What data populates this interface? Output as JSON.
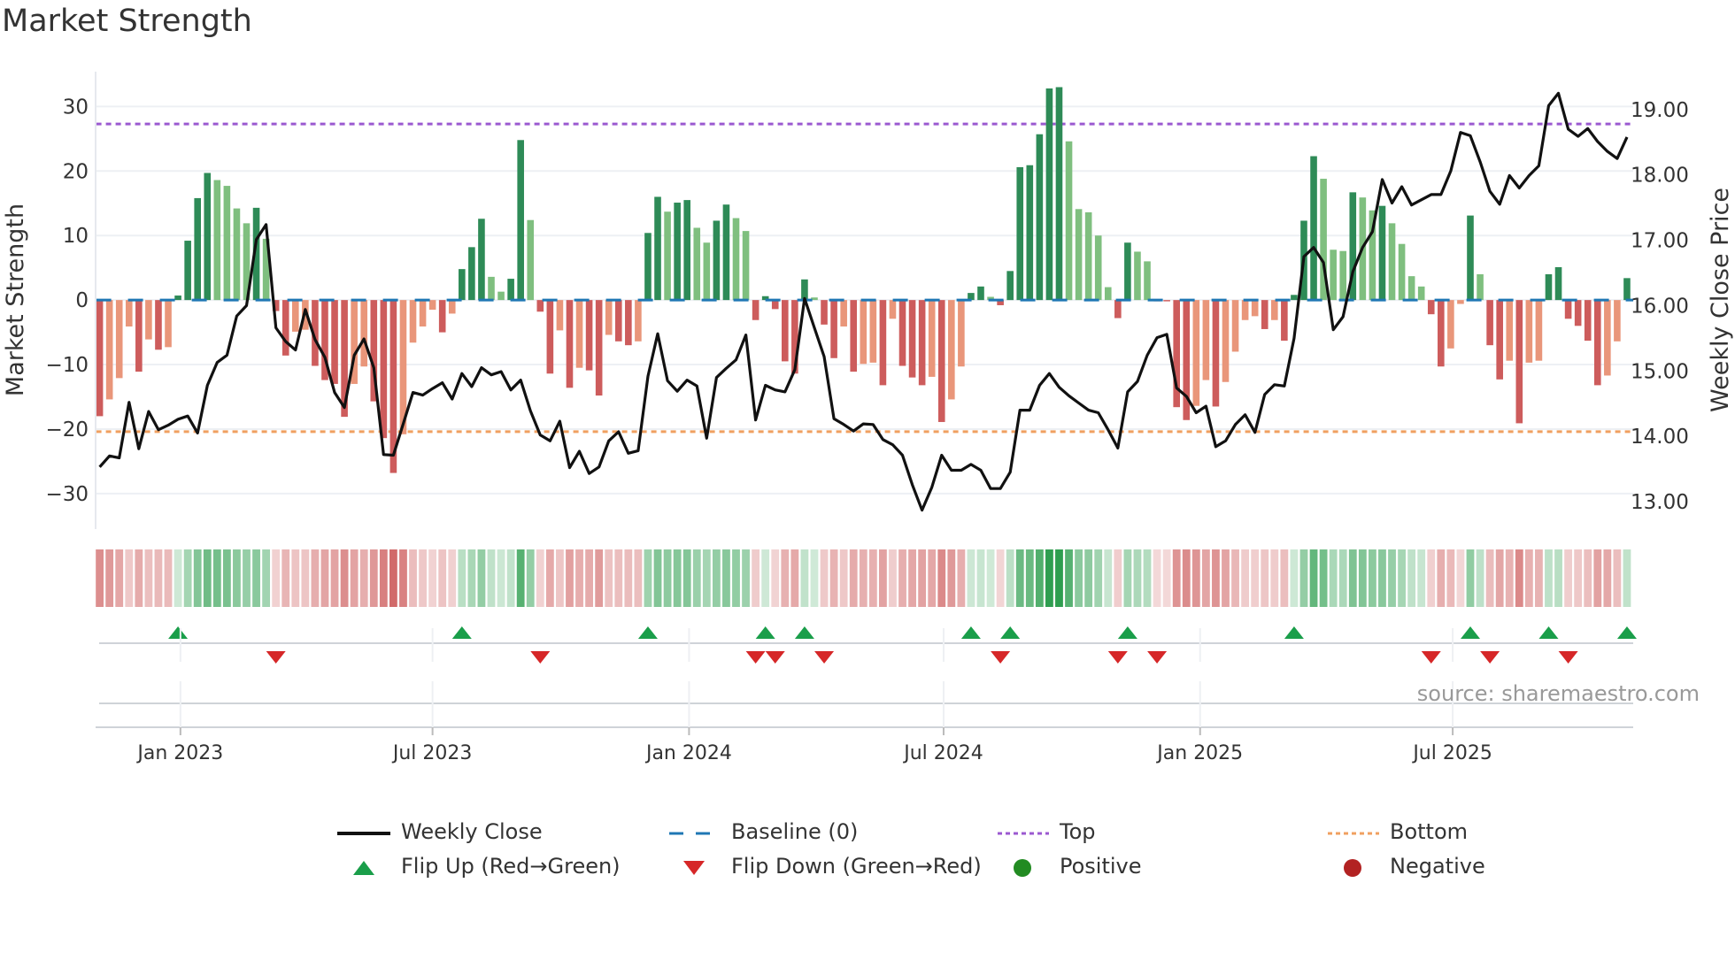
{
  "title": "Market Strength",
  "source": "source: sharemaestro.com",
  "colors": {
    "pos_strong": "#2e8b57",
    "pos_weak": "#7fbf7f",
    "neg_strong": "#cd5c5c",
    "neg_weak": "#e9967a",
    "price": "#111111",
    "baseline": "#1f77b4",
    "top": "#9b59d0",
    "bottom": "#f0a060",
    "flip_up": "#1a9e4a",
    "flip_down": "#d62728",
    "positive": "#228b22",
    "negative": "#b22222"
  },
  "legend": {
    "weekly_close": "Weekly Close",
    "baseline": "Baseline (0)",
    "top": "Top",
    "bottom": "Bottom",
    "flip_up": "Flip Up (Red→Green)",
    "flip_down": "Flip Down (Green→Red)",
    "positive": "Positive",
    "negative": "Negative"
  },
  "chart_data": {
    "type": "bar",
    "title": "Market Strength",
    "ylabel": "Market Strength",
    "y2label": "Weekly Close Price",
    "ylim": [
      -35.5,
      35.4
    ],
    "y2lim": [
      12.58,
      19.58
    ],
    "yticks": [
      -30,
      -20,
      -10,
      0,
      10,
      20,
      30
    ],
    "yticklabels": [
      "−30",
      "−20",
      "−10",
      "0",
      "10",
      "20",
      "30"
    ],
    "y2ticks": [
      13,
      14,
      15,
      16,
      17,
      18,
      19
    ],
    "y2ticklabels": [
      "13.00",
      "14.00",
      "15.00",
      "16.00",
      "17.00",
      "18.00",
      "19.00"
    ],
    "top_level": 27.3,
    "bottom_level": -20.4,
    "baseline": 0,
    "xticks": [
      {
        "week": 8.25,
        "label": "Jan 2023"
      },
      {
        "week": 34.0,
        "label": "Jul 2023"
      },
      {
        "week": 60.2,
        "label": "Jan 2024"
      },
      {
        "week": 86.2,
        "label": "Jul 2024"
      },
      {
        "week": 112.4,
        "label": "Jan 2025"
      },
      {
        "week": 138.2,
        "label": "Jul 2025"
      }
    ],
    "strength": [
      -18.0,
      -15.4,
      -12.1,
      -4.1,
      -11.1,
      -6.1,
      -7.7,
      -7.3,
      0.7,
      9.2,
      15.8,
      19.7,
      18.6,
      17.7,
      14.2,
      11.9,
      14.3,
      9.5,
      -1.7,
      -8.6,
      -4.9,
      -4.6,
      -10.2,
      -12.4,
      -13.0,
      -18.1,
      -13.0,
      -10.3,
      -15.7,
      -21.4,
      -26.8,
      -20.8,
      -6.6,
      -4.1,
      -1.5,
      -5.0,
      -2.1,
      4.8,
      8.2,
      12.6,
      3.6,
      1.3,
      3.3,
      24.8,
      12.4,
      -1.8,
      -11.4,
      -4.7,
      -13.6,
      -10.5,
      -10.9,
      -14.8,
      -5.4,
      -6.4,
      -7.0,
      -6.4,
      10.4,
      16.0,
      13.7,
      15.1,
      15.5,
      11.2,
      8.9,
      12.3,
      14.8,
      12.7,
      10.7,
      -3.1,
      0.6,
      -1.4,
      -9.5,
      -11.4,
      3.2,
      0.4,
      -3.8,
      -9.0,
      -4.1,
      -11.1,
      -9.9,
      -9.7,
      -13.2,
      -2.9,
      -10.2,
      -12.0,
      -13.2,
      -11.9,
      -18.9,
      -15.4,
      -10.3,
      1.1,
      2.1,
      0.5,
      -0.8,
      4.5,
      20.6,
      20.9,
      25.7,
      32.8,
      33.0,
      24.6,
      14.1,
      13.6,
      10.0,
      2.0,
      -2.8,
      8.9,
      7.5,
      6.0,
      -0.2,
      -0.2,
      -16.6,
      -18.6,
      -16.4,
      -12.4,
      -16.5,
      -12.7,
      -8.0,
      -3.1,
      -2.5,
      -4.5,
      -3.1,
      -6.3,
      0.8,
      12.3,
      22.3,
      18.8,
      7.8,
      7.6,
      16.7,
      15.9,
      13.9,
      14.6,
      11.9,
      8.7,
      3.7,
      2.1,
      -2.2,
      -10.3,
      -7.5,
      -0.6,
      13.1,
      4.0,
      -7.0,
      -12.3,
      -9.4,
      -19.1,
      -9.7,
      -9.4,
      4.0,
      5.1,
      -2.9,
      -4.0,
      -6.3,
      -13.2,
      -11.7,
      -6.4,
      3.4
    ],
    "weekly_close": [
      13.53,
      13.7,
      13.67,
      14.52,
      13.81,
      14.38,
      14.1,
      14.17,
      14.26,
      14.31,
      14.05,
      14.78,
      15.13,
      15.24,
      15.84,
      16.0,
      17.01,
      17.24,
      15.66,
      15.45,
      15.32,
      15.94,
      15.48,
      15.21,
      14.67,
      14.44,
      15.24,
      15.49,
      15.05,
      13.72,
      13.71,
      14.19,
      14.67,
      14.63,
      14.73,
      14.82,
      14.57,
      14.96,
      14.76,
      15.05,
      14.94,
      14.99,
      14.71,
      14.86,
      14.39,
      14.02,
      13.93,
      14.23,
      13.52,
      13.77,
      13.43,
      13.53,
      13.93,
      14.07,
      13.74,
      13.78,
      14.92,
      15.57,
      14.85,
      14.69,
      14.86,
      14.77,
      13.97,
      14.9,
      15.04,
      15.17,
      15.55,
      14.25,
      14.78,
      14.71,
      14.68,
      15.02,
      16.11,
      15.66,
      15.22,
      14.27,
      14.18,
      14.08,
      14.19,
      14.18,
      13.95,
      13.87,
      13.71,
      13.26,
      12.87,
      13.22,
      13.71,
      13.48,
      13.48,
      13.57,
      13.48,
      13.2,
      13.2,
      13.45,
      14.4,
      14.4,
      14.78,
      14.96,
      14.75,
      14.62,
      14.51,
      14.4,
      14.36,
      14.1,
      13.82,
      14.68,
      14.84,
      15.24,
      15.51,
      15.56,
      14.74,
      14.61,
      14.36,
      14.46,
      13.84,
      13.93,
      14.18,
      14.33,
      14.06,
      14.64,
      14.79,
      14.77,
      15.5,
      16.75,
      16.89,
      16.66,
      15.63,
      15.83,
      16.52,
      16.89,
      17.13,
      17.93,
      17.57,
      17.82,
      17.54,
      17.62,
      17.7,
      17.7,
      18.06,
      18.65,
      18.6,
      18.2,
      17.75,
      17.55,
      17.99,
      17.8,
      17.99,
      18.14,
      19.06,
      19.25,
      18.7,
      18.59,
      18.71,
      18.51,
      18.36,
      18.25,
      18.58
    ]
  }
}
